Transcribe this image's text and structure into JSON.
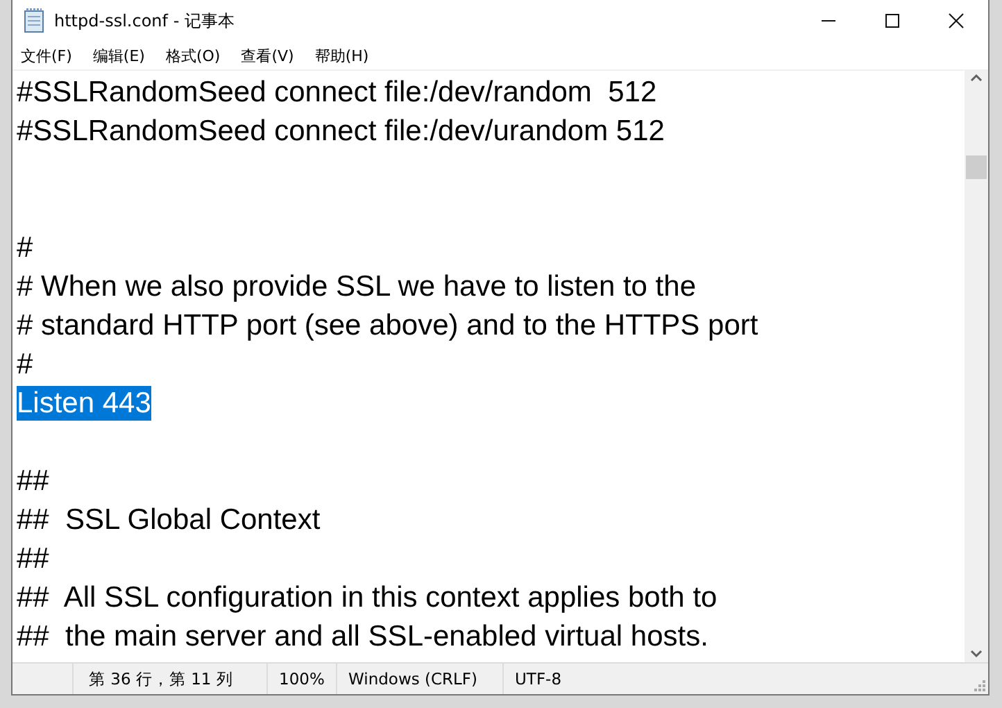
{
  "window": {
    "title": "httpd-ssl.conf - 记事本"
  },
  "menu": [
    {
      "label": "文件(F)"
    },
    {
      "label": "编辑(E)"
    },
    {
      "label": "格式(O)"
    },
    {
      "label": "查看(V)"
    },
    {
      "label": "帮助(H)"
    }
  ],
  "lines": [
    {
      "kind": "text",
      "text": "#SSLRandomSeed connect file:/dev/random  512",
      "selected": false
    },
    {
      "kind": "text",
      "text": "#SSLRandomSeed connect file:/dev/urandom 512",
      "selected": false
    },
    {
      "kind": "blank"
    },
    {
      "kind": "blank"
    },
    {
      "kind": "text",
      "text": "#",
      "selected": false
    },
    {
      "kind": "text",
      "text": "# When we also provide SSL we have to listen to the",
      "selected": false
    },
    {
      "kind": "text",
      "text": "# standard HTTP port (see above) and to the HTTPS port",
      "selected": false
    },
    {
      "kind": "text",
      "text": "#",
      "selected": false
    },
    {
      "kind": "text",
      "text": "Listen 443",
      "selected": true
    },
    {
      "kind": "blank"
    },
    {
      "kind": "text",
      "text": "##",
      "selected": false
    },
    {
      "kind": "text",
      "text": "##  SSL Global Context",
      "selected": false
    },
    {
      "kind": "text",
      "text": "##",
      "selected": false
    },
    {
      "kind": "text",
      "text": "##  All SSL configuration in this context applies both to",
      "selected": false
    },
    {
      "kind": "text",
      "text": "##  the main server and all SSL-enabled virtual hosts.",
      "selected": false
    }
  ],
  "status_bar": {
    "position": "第 36 行，第 11 列",
    "zoom": "100%",
    "line_ending": "Windows (CRLF)",
    "encoding": "UTF-8"
  }
}
